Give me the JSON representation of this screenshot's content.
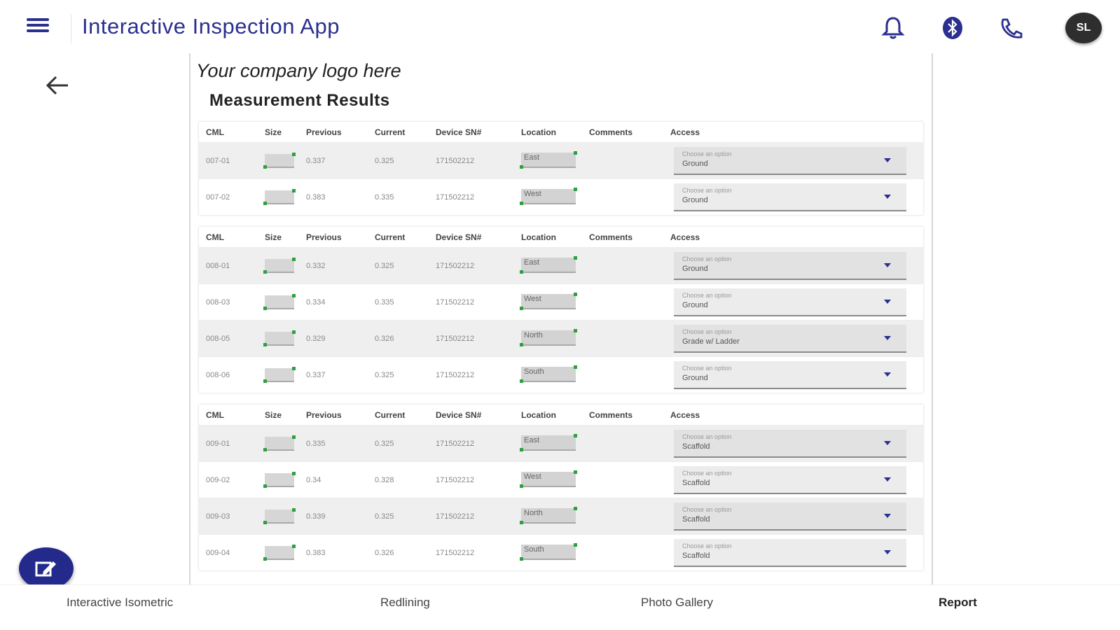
{
  "header": {
    "title": "Interactive Inspection App",
    "avatar_initials": "SL",
    "icons": [
      "menu-icon",
      "bell-icon",
      "bluetooth-icon",
      "phone-icon"
    ],
    "accent_color": "#2b2f8f"
  },
  "report": {
    "logo_text": "Your company logo here",
    "title": "Measurement Results",
    "columns": [
      "CML",
      "Size",
      "Previous",
      "Current",
      "Device SN#",
      "Location",
      "Comments",
      "Access"
    ],
    "select_placeholder": "Choose an option",
    "groups": [
      {
        "rows": [
          {
            "cml": "007-01",
            "previous": "0.337",
            "current": "0.325",
            "device": "171502212",
            "location": "East",
            "access": "Ground"
          },
          {
            "cml": "007-02",
            "previous": "0.383",
            "current": "0.335",
            "device": "171502212",
            "location": "West",
            "access": "Ground"
          }
        ]
      },
      {
        "rows": [
          {
            "cml": "008-01",
            "previous": "0.332",
            "current": "0.325",
            "device": "171502212",
            "location": "East",
            "access": "Ground"
          },
          {
            "cml": "008-03",
            "previous": "0.334",
            "current": "0.335",
            "device": "171502212",
            "location": "West",
            "access": "Ground"
          },
          {
            "cml": "008-05",
            "previous": "0.329",
            "current": "0.326",
            "device": "171502212",
            "location": "North",
            "access": "Grade w/ Ladder"
          },
          {
            "cml": "008-06",
            "previous": "0.337",
            "current": "0.325",
            "device": "171502212",
            "location": "South",
            "access": "Ground"
          }
        ]
      },
      {
        "rows": [
          {
            "cml": "009-01",
            "previous": "0.335",
            "current": "0.325",
            "device": "171502212",
            "location": "East",
            "access": "Scaffold"
          },
          {
            "cml": "009-02",
            "previous": "0.34",
            "current": "0.328",
            "device": "171502212",
            "location": "West",
            "access": "Scaffold"
          },
          {
            "cml": "009-03",
            "previous": "0.339",
            "current": "0.325",
            "device": "171502212",
            "location": "North",
            "access": "Scaffold"
          },
          {
            "cml": "009-04",
            "previous": "0.383",
            "current": "0.326",
            "device": "171502212",
            "location": "South",
            "access": "Scaffold"
          }
        ]
      }
    ]
  },
  "bottom_nav": [
    {
      "label": "Interactive Isometric",
      "active": false
    },
    {
      "label": "Redlining",
      "active": false
    },
    {
      "label": "Photo Gallery",
      "active": false
    },
    {
      "label": "Report",
      "active": true
    }
  ]
}
